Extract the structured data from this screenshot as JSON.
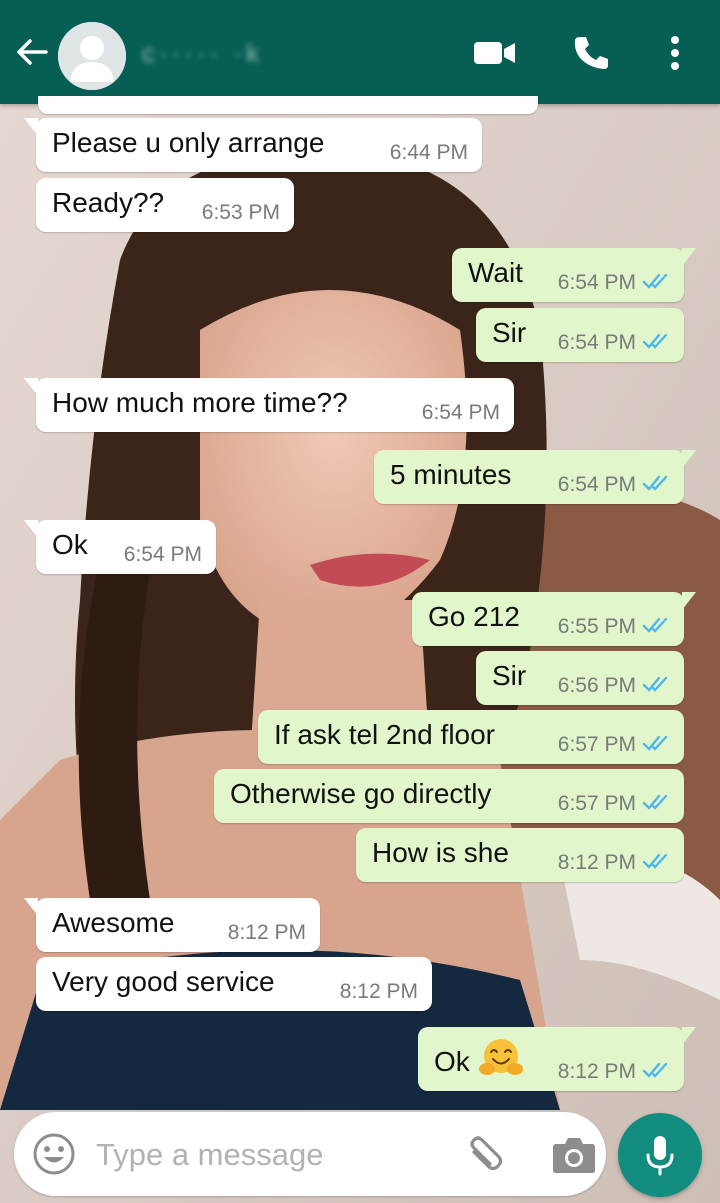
{
  "header": {
    "contact_name": "c·····  ·k",
    "icons": [
      "back-arrow-icon",
      "avatar-placeholder-icon",
      "video-call-icon",
      "phone-icon",
      "more-vert-icon"
    ]
  },
  "messages": [
    {
      "direction": "in",
      "text": "Please u only arrange",
      "time": "6:44 PM"
    },
    {
      "direction": "in",
      "text": "Ready??",
      "time": "6:53 PM"
    },
    {
      "direction": "out",
      "text": "Wait",
      "time": "6:54 PM",
      "status": "read"
    },
    {
      "direction": "out",
      "text": "Sir",
      "time": "6:54 PM",
      "status": "read"
    },
    {
      "direction": "in",
      "text": "How much more time??",
      "time": "6:54 PM"
    },
    {
      "direction": "out",
      "text": "5 minutes",
      "time": "6:54 PM",
      "status": "read"
    },
    {
      "direction": "in",
      "text": "Ok",
      "time": "6:54 PM"
    },
    {
      "direction": "out",
      "text": "Go 212",
      "time": "6:55 PM",
      "status": "read"
    },
    {
      "direction": "out",
      "text": "Sir",
      "time": "6:56 PM",
      "status": "read"
    },
    {
      "direction": "out",
      "text": "If ask tel 2nd floor",
      "time": "6:57 PM",
      "status": "read"
    },
    {
      "direction": "out",
      "text": "Otherwise go directly",
      "time": "6:57 PM",
      "status": "read"
    },
    {
      "direction": "out",
      "text": "How is she",
      "time": "8:12 PM",
      "status": "read"
    },
    {
      "direction": "in",
      "text": "Awesome",
      "time": "8:12 PM"
    },
    {
      "direction": "in",
      "text": "Very good service",
      "time": "8:12 PM"
    },
    {
      "direction": "out",
      "text": "Ok",
      "time": "8:12 PM",
      "status": "read",
      "emoji": "hugging-face-emoji"
    }
  ],
  "composer": {
    "placeholder": "Type a message",
    "icons": [
      "emoji-icon",
      "attach-icon",
      "camera-icon",
      "mic-icon"
    ]
  },
  "colors": {
    "header": "#075e54",
    "outgoing_bubble": "#e1f7cb",
    "incoming_bubble": "#ffffff",
    "read_ticks": "#4fb6ec",
    "mic_button": "#128c7e"
  }
}
